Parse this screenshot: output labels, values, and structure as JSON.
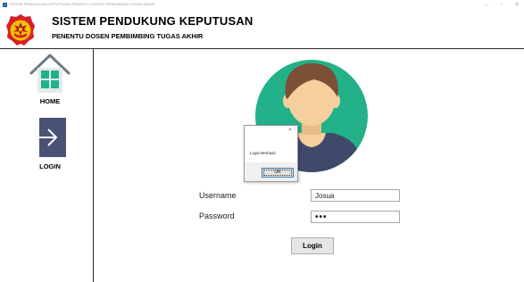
{
  "window": {
    "title": "SISTEM PENDUKUNG KEPUTUSAN PENENTU DOSEN PEMBIMBING TUGAS AKHIR",
    "minimize_glyph": "–",
    "maximize_glyph": "▫",
    "close_glyph": "✕"
  },
  "header": {
    "title": "SISTEM PENDUKUNG KEPUTUSAN",
    "subtitle": "PENENTU DOSEN PEMBIMBING TUGAS AKHIR",
    "logo_icon": "university-emblem-icon"
  },
  "sidebar": {
    "items": [
      {
        "label": "HOME",
        "icon": "home-icon"
      },
      {
        "label": "LOGIN",
        "icon": "login-arrow-icon"
      }
    ]
  },
  "avatar": {
    "icon": "user-avatar-icon"
  },
  "form": {
    "username_label": "Username",
    "username_value": "Josua",
    "password_label": "Password",
    "password_value": "•••",
    "login_label": "Login"
  },
  "dialog": {
    "message": "Login Berhasil",
    "ok_label": "OK",
    "close_glyph": "×"
  },
  "colors": {
    "avatar_bg": "#23b18a",
    "avatar_hair": "#7b5036",
    "avatar_skin": "#f6cf9e",
    "avatar_shirt": "#3f4a6b",
    "home_roof": "#6f7b86",
    "home_windows": "#20b18a",
    "login_box": "#4a5275"
  }
}
